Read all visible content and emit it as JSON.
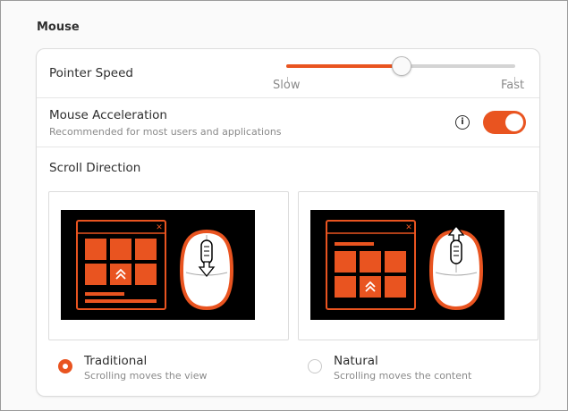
{
  "section": {
    "title": "Mouse"
  },
  "pointer_speed": {
    "label": "Pointer Speed",
    "min_label": "Slow",
    "max_label": "Fast",
    "value_fraction": 0.5
  },
  "acceleration": {
    "label": "Mouse Acceleration",
    "subtitle": "Recommended for most users and applications",
    "info_icon_glyph": "i",
    "enabled": true
  },
  "scroll_direction": {
    "label": "Scroll Direction",
    "options": [
      {
        "label": "Traditional",
        "subtitle": "Scrolling moves the view",
        "selected": true
      },
      {
        "label": "Natural",
        "subtitle": "Scrolling moves the content",
        "selected": false
      }
    ]
  },
  "colors": {
    "accent": "#e95420",
    "illustration_bg": "#000000"
  }
}
